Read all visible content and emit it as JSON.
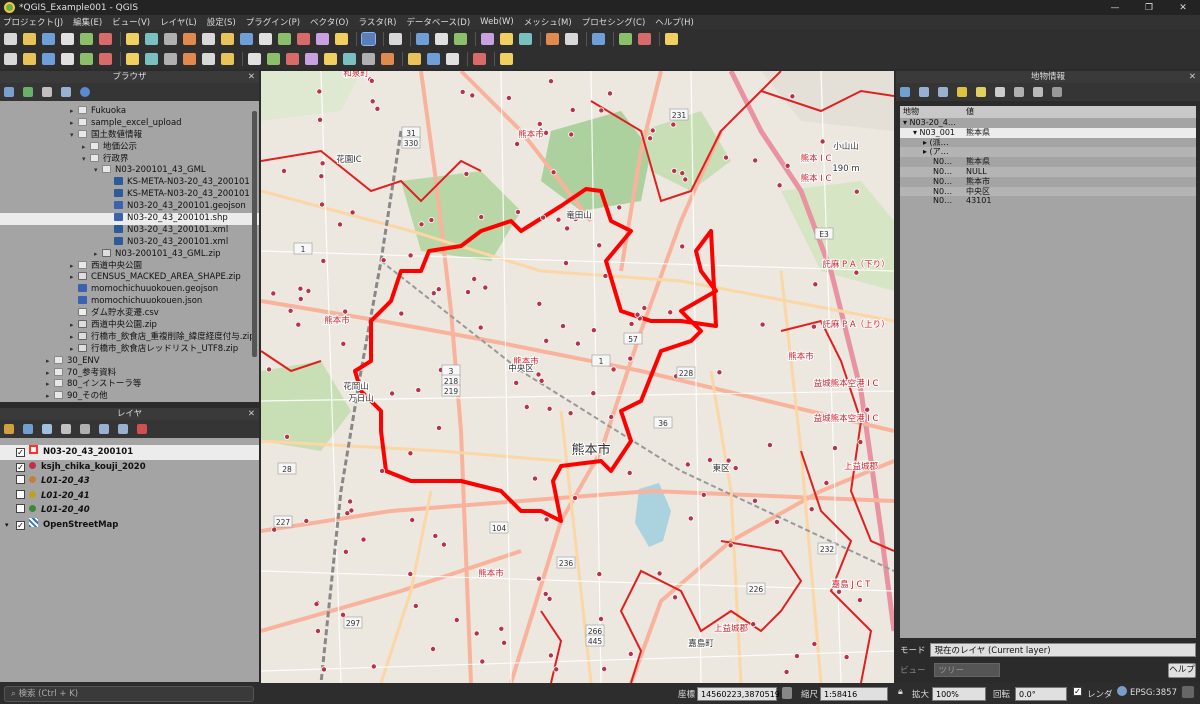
{
  "window": {
    "title": "*QGIS_Example001 - QGIS"
  },
  "menu": [
    "プロジェクト(J)",
    "編集(E)",
    "ビュー(V)",
    "レイヤ(L)",
    "設定(S)",
    "プラグイン(P)",
    "ベクタ(O)",
    "ラスタ(R)",
    "データベース(D)",
    "Web(W)",
    "メッシュ(M)",
    "プロセシング(C)",
    "ヘルプ(H)"
  ],
  "browser": {
    "title": "ブラウザ",
    "items": [
      {
        "label": "Fukuoka",
        "type": "folder",
        "depth": 1,
        "expanded": false
      },
      {
        "label": "sample_excel_upload",
        "type": "folder",
        "depth": 1,
        "expanded": false
      },
      {
        "label": "国土数値情報",
        "type": "folder",
        "depth": 1,
        "expanded": true
      },
      {
        "label": "地価公示",
        "type": "folder",
        "depth": 2,
        "expanded": false
      },
      {
        "label": "行政界",
        "type": "folder",
        "depth": 2,
        "expanded": true
      },
      {
        "label": "N03-200101_43_GML",
        "type": "folder",
        "depth": 3,
        "expanded": true
      },
      {
        "label": "KS-META-N03-20_43_200101",
        "type": "xml",
        "depth": 4
      },
      {
        "label": "KS-META-N03-20_43_200101",
        "type": "xml",
        "depth": 4
      },
      {
        "label": "N03-20_43_200101.geojson",
        "type": "vec",
        "depth": 4
      },
      {
        "label": "N03-20_43_200101.shp",
        "type": "vec",
        "depth": 4,
        "selected": true
      },
      {
        "label": "N03-20_43_200101.xml",
        "type": "xml",
        "depth": 4
      },
      {
        "label": "N03-20_43_200101.xml",
        "type": "xml",
        "depth": 4
      },
      {
        "label": "N03-200101_43_GML.zip",
        "type": "zip",
        "depth": 3,
        "expanded": false
      },
      {
        "label": "西道中央公園",
        "type": "folder",
        "depth": 1,
        "expanded": false
      },
      {
        "label": "CENSUS_MACKED_AREA_SHAPE.zip",
        "type": "zip",
        "depth": 1,
        "expanded": false
      },
      {
        "label": "momochichuuokouen.geojson",
        "type": "vec",
        "depth": 1
      },
      {
        "label": "momochichuuokouen.json",
        "type": "vec",
        "depth": 1
      },
      {
        "label": "ダム貯水変遷.csv",
        "type": "csv",
        "depth": 1
      },
      {
        "label": "西道中央公園.zip",
        "type": "zip",
        "depth": 1,
        "expanded": false
      },
      {
        "label": "行橋市_飲食店_重複削除_緯度経度付与.zip",
        "type": "zip",
        "depth": 1,
        "expanded": false
      },
      {
        "label": "行橋市_飲食店レッドリスト_UTF8.zip",
        "type": "zip",
        "depth": 1,
        "expanded": false
      },
      {
        "label": "30_ENV",
        "type": "folder",
        "depth": 0,
        "expanded": false
      },
      {
        "label": "70_参考資料",
        "type": "folder",
        "depth": 0,
        "expanded": false
      },
      {
        "label": "80_インストーラ等",
        "type": "folder",
        "depth": 0,
        "expanded": false
      },
      {
        "label": "90_その他",
        "type": "folder",
        "depth": 0,
        "expanded": false
      }
    ]
  },
  "layers": {
    "title": "レイヤ",
    "items": [
      {
        "label": "N03-20_43_200101",
        "checked": true,
        "symbol": "#ff3030",
        "bold": true,
        "selected": true
      },
      {
        "label": "ksjh_chika_kouji_2020",
        "checked": true,
        "symbol": "#c0304a",
        "bold": true
      },
      {
        "label": "L01-20_43",
        "checked": false,
        "symbol": "#c08040",
        "bold": true
      },
      {
        "label": "L01-20_41",
        "checked": false,
        "symbol": "#c0a020",
        "bold": true
      },
      {
        "label": "L01-20_40",
        "checked": false,
        "symbol": "#3a8a3a",
        "bold": true
      },
      {
        "label": "OpenStreetMap",
        "checked": true,
        "symbol": "#3070c0",
        "bold": true,
        "raster": true
      }
    ]
  },
  "identify": {
    "title": "地物情報",
    "col_feature": "地物",
    "col_value": "値",
    "rows": [
      {
        "a": "▾ N03-20_4…",
        "b": "",
        "indent": 0
      },
      {
        "a": "▾ N03_001",
        "b": "熊本県",
        "indent": 1,
        "selected": true
      },
      {
        "a": "▸ (派…",
        "b": "",
        "indent": 2
      },
      {
        "a": "▸ (ア…",
        "b": "",
        "indent": 2
      },
      {
        "a": "N0…",
        "b": "熊本県",
        "indent": 3
      },
      {
        "a": "N0…",
        "b": "NULL",
        "indent": 3
      },
      {
        "a": "N0…",
        "b": "熊本市",
        "indent": 3
      },
      {
        "a": "N0…",
        "b": "中央区",
        "indent": 3
      },
      {
        "a": "N0…",
        "b": "43101",
        "indent": 3
      }
    ],
    "mode_label": "モード",
    "mode_value": "現在のレイヤ (Current layer)",
    "view_label": "ビュー",
    "view_value": "ツリー",
    "help_button": "ヘルプ"
  },
  "map_labels": [
    {
      "text": "熊本市",
      "color": "#d0202a"
    },
    {
      "text": "熊本市",
      "color": "#d0202a"
    },
    {
      "text": "熊本市",
      "color": "#d0202a"
    },
    {
      "text": "熊本市",
      "color": "#d0202a"
    },
    {
      "text": "熊本市",
      "color": "#d0202a"
    },
    {
      "text": "中央区",
      "color": "#333333"
    },
    {
      "text": "東区",
      "color": "#333333"
    },
    {
      "text": "熊本市",
      "color": "#333333"
    },
    {
      "text": "熊本 I C",
      "color": "#d0202a"
    },
    {
      "text": "熊本 I C",
      "color": "#d0202a"
    },
    {
      "text": "託麻 P A（下り）",
      "color": "#d0202a"
    },
    {
      "text": "託麻 P A（上り）",
      "color": "#d0202a"
    },
    {
      "text": "益城熊本空港 I C",
      "color": "#d0202a"
    },
    {
      "text": "益城熊本空港 I C",
      "color": "#d0202a"
    },
    {
      "text": "上益城郡",
      "color": "#d0202a"
    },
    {
      "text": "上益城郡",
      "color": "#d0202a"
    },
    {
      "text": "嘉島 J C T",
      "color": "#d0202a"
    },
    {
      "text": "嘉島町",
      "color": "#333333"
    },
    {
      "text": "花園IC",
      "color": "#333333"
    },
    {
      "text": "和泉町",
      "color": "#d0202a"
    },
    {
      "text": "竜田山",
      "color": "#333333"
    },
    {
      "text": "小山山",
      "color": "#333333"
    },
    {
      "text": "190 m",
      "color": "#333333"
    },
    {
      "text": "万日山",
      "color": "#333333"
    },
    {
      "text": "花岡山",
      "color": "#333333"
    }
  ],
  "road_numbers": [
    "31",
    "330",
    "231",
    "57",
    "3",
    "218",
    "219",
    "228",
    "36",
    "104",
    "236",
    "266",
    "445",
    "226",
    "297",
    "227",
    "232",
    "28",
    "1",
    "E3",
    "1"
  ],
  "statusbar": {
    "search_placeholder": "検索 (Ctrl + K)",
    "coord_label": "座標",
    "coord_value": "14560223,3870519",
    "scale_label": "縮尺",
    "scale_value": "1:58416",
    "magnifier_label": "拡大",
    "magnifier_value": "100%",
    "rotation_label": "回転",
    "rotation_value": "0.0°",
    "render_label": "レンダ",
    "crs_label": "EPSG:3857"
  }
}
